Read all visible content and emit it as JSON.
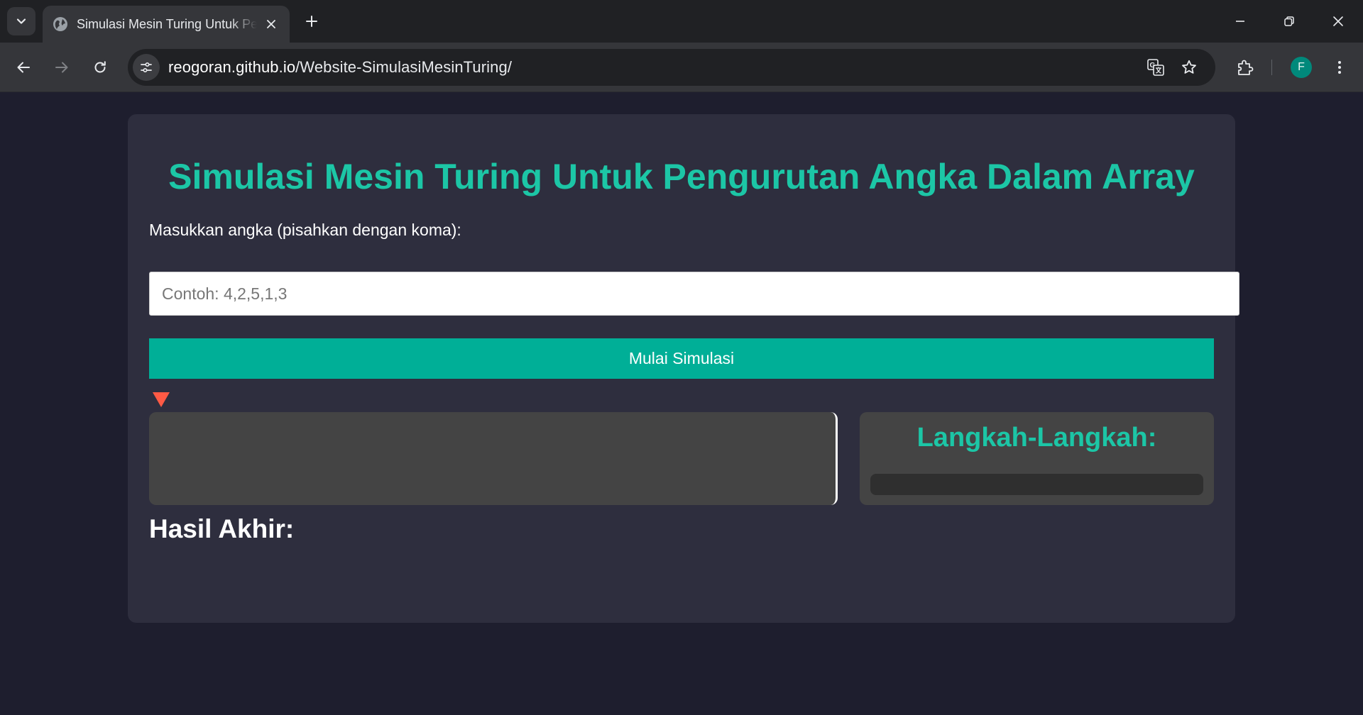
{
  "browser": {
    "tab_title": "Simulasi Mesin Turing Untuk Pengurutan Angka Dalam Array",
    "url_host": "reogoran.github.io",
    "url_path": "/Website-SimulasiMesinTuring/",
    "profile_initial": "F"
  },
  "page": {
    "heading": "Simulasi Mesin Turing Untuk Pengurutan Angka Dalam Array",
    "input_label": "Masukkan angka (pisahkan dengan koma):",
    "input_placeholder": "Contoh: 4,2,5,1,3",
    "input_value": "",
    "start_button_label": "Mulai Simulasi",
    "steps_title": "Langkah-Langkah:",
    "result_title": "Hasil Akhir:"
  },
  "colors": {
    "accent": "#1cc6a6",
    "button": "#00af97",
    "head_marker": "#ff5a45",
    "page_bg": "#1e1e2e",
    "card_bg": "#2e2e3e",
    "panel_bg": "#444444"
  },
  "icons": {
    "tab_search": "chevron-down-icon",
    "favicon": "globe-icon",
    "tab_close": "close-icon",
    "new_tab": "plus-icon",
    "minimize": "minimize-icon",
    "restore": "restore-icon",
    "close_window": "close-icon",
    "back": "arrow-left-icon",
    "forward": "arrow-right-icon",
    "reload": "reload-icon",
    "site_info": "tune-icon",
    "translate": "translate-icon",
    "bookmark": "star-icon",
    "extensions": "puzzle-icon",
    "menu": "kebab-menu-icon",
    "tape_head": "triangle-down-icon"
  }
}
